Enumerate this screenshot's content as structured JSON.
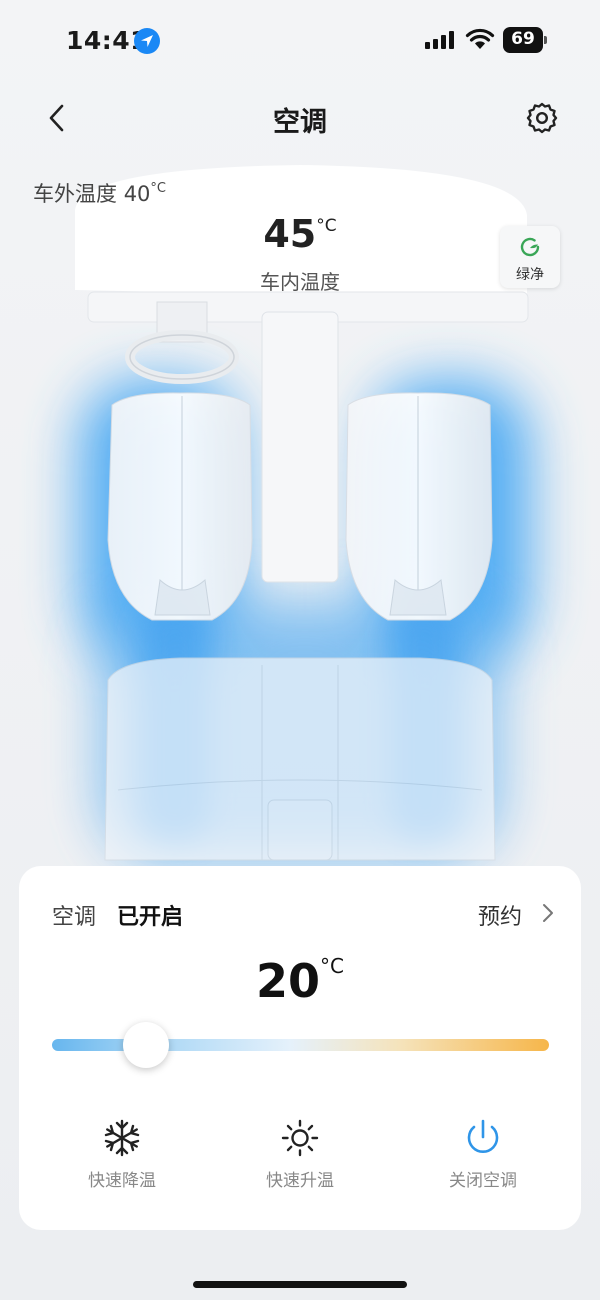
{
  "status_bar": {
    "time": "14:41",
    "battery": "69"
  },
  "header": {
    "title": "空调"
  },
  "climate": {
    "outside_label": "车外温度",
    "outside_temp": "40",
    "inside_temp": "45",
    "inside_label": "车内温度",
    "unit": "°C",
    "green_clean_label": "绿净"
  },
  "control": {
    "ac_label": "空调",
    "ac_status": "已开启",
    "schedule_label": "预约",
    "set_temp": "20",
    "unit": "°C",
    "slider_fraction": 0.19,
    "actions": [
      {
        "label": "快速降温",
        "icon": "snowflake-icon"
      },
      {
        "label": "快速升温",
        "icon": "sun-icon"
      },
      {
        "label": "关闭空调",
        "icon": "power-icon"
      }
    ],
    "accent_color": "#2f95e8"
  }
}
